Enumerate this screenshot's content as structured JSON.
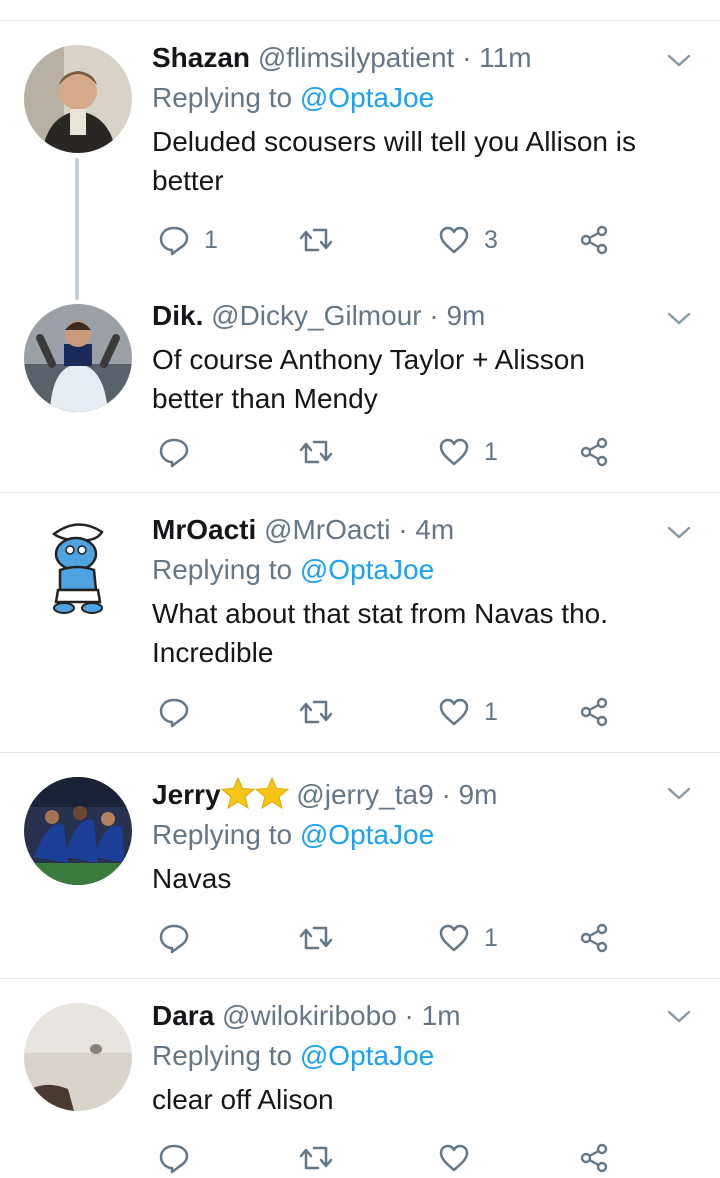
{
  "tweets": [
    {
      "name": "Shazan",
      "handle": "@flimsilypatient",
      "time": "· 11m",
      "replying_label": "Replying to",
      "replying_to": "@OptaJoe",
      "text_lines": [
        "Deluded scousers will tell you Allison is",
        "better"
      ],
      "replies": "1",
      "retweets": "",
      "likes": "3"
    },
    {
      "name": "Dik.",
      "handle": "@Dicky_Gilmour",
      "time": "· 9m",
      "text_lines": [
        "Of course Anthony Taylor + Alisson",
        "better than Mendy"
      ],
      "replies": "",
      "retweets": "",
      "likes": "1"
    },
    {
      "name": "MrOacti",
      "handle": "@MrOacti",
      "time": "· 4m",
      "replying_label": "Replying to",
      "replying_to": "@OptaJoe",
      "text_lines": [
        "What about that stat from Navas tho.",
        "Incredible"
      ],
      "replies": "",
      "retweets": "",
      "likes": "1"
    },
    {
      "name": "Jerry",
      "handle": "@jerry_ta9",
      "time": "· 9m",
      "replying_label": "Replying to",
      "replying_to": "@OptaJoe",
      "text_lines": [
        "Navas"
      ],
      "replies": "",
      "retweets": "",
      "likes": "1"
    },
    {
      "name": "Dara",
      "handle": "@wilokiribobo",
      "time": "· 1m",
      "replying_label": "Replying to",
      "replying_to": "@OptaJoe",
      "text_lines": [
        "clear off Alison"
      ],
      "replies": "",
      "retweets": "",
      "likes": ""
    }
  ],
  "colors": {
    "link": "#1da1f2",
    "muted": "#657786",
    "text": "#14171a",
    "star": "#f5c518"
  }
}
